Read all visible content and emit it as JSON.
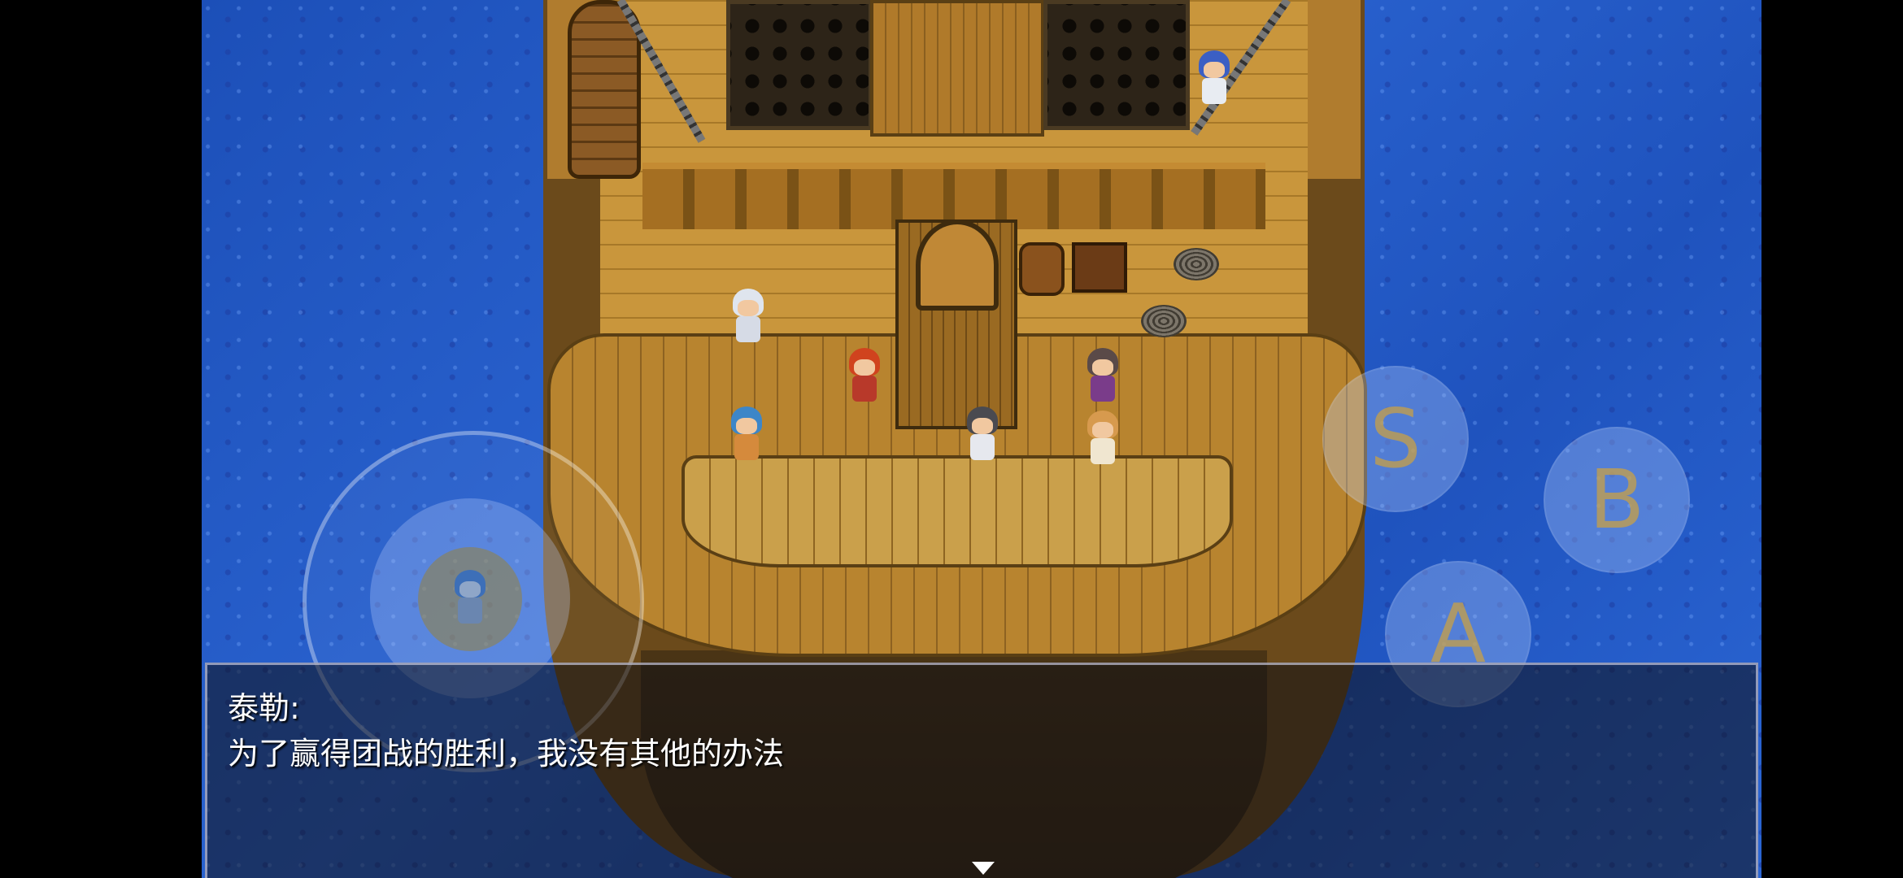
{
  "dialogue": {
    "speaker": "泰勒:",
    "text": "为了赢得团战的胜利，我没有其他的办法"
  },
  "controls": {
    "button_s": "S",
    "button_b": "B",
    "button_a": "A"
  },
  "colors": {
    "sea": "#2a63d0",
    "deck": "#c9963c",
    "button_text": "#c8a046"
  }
}
